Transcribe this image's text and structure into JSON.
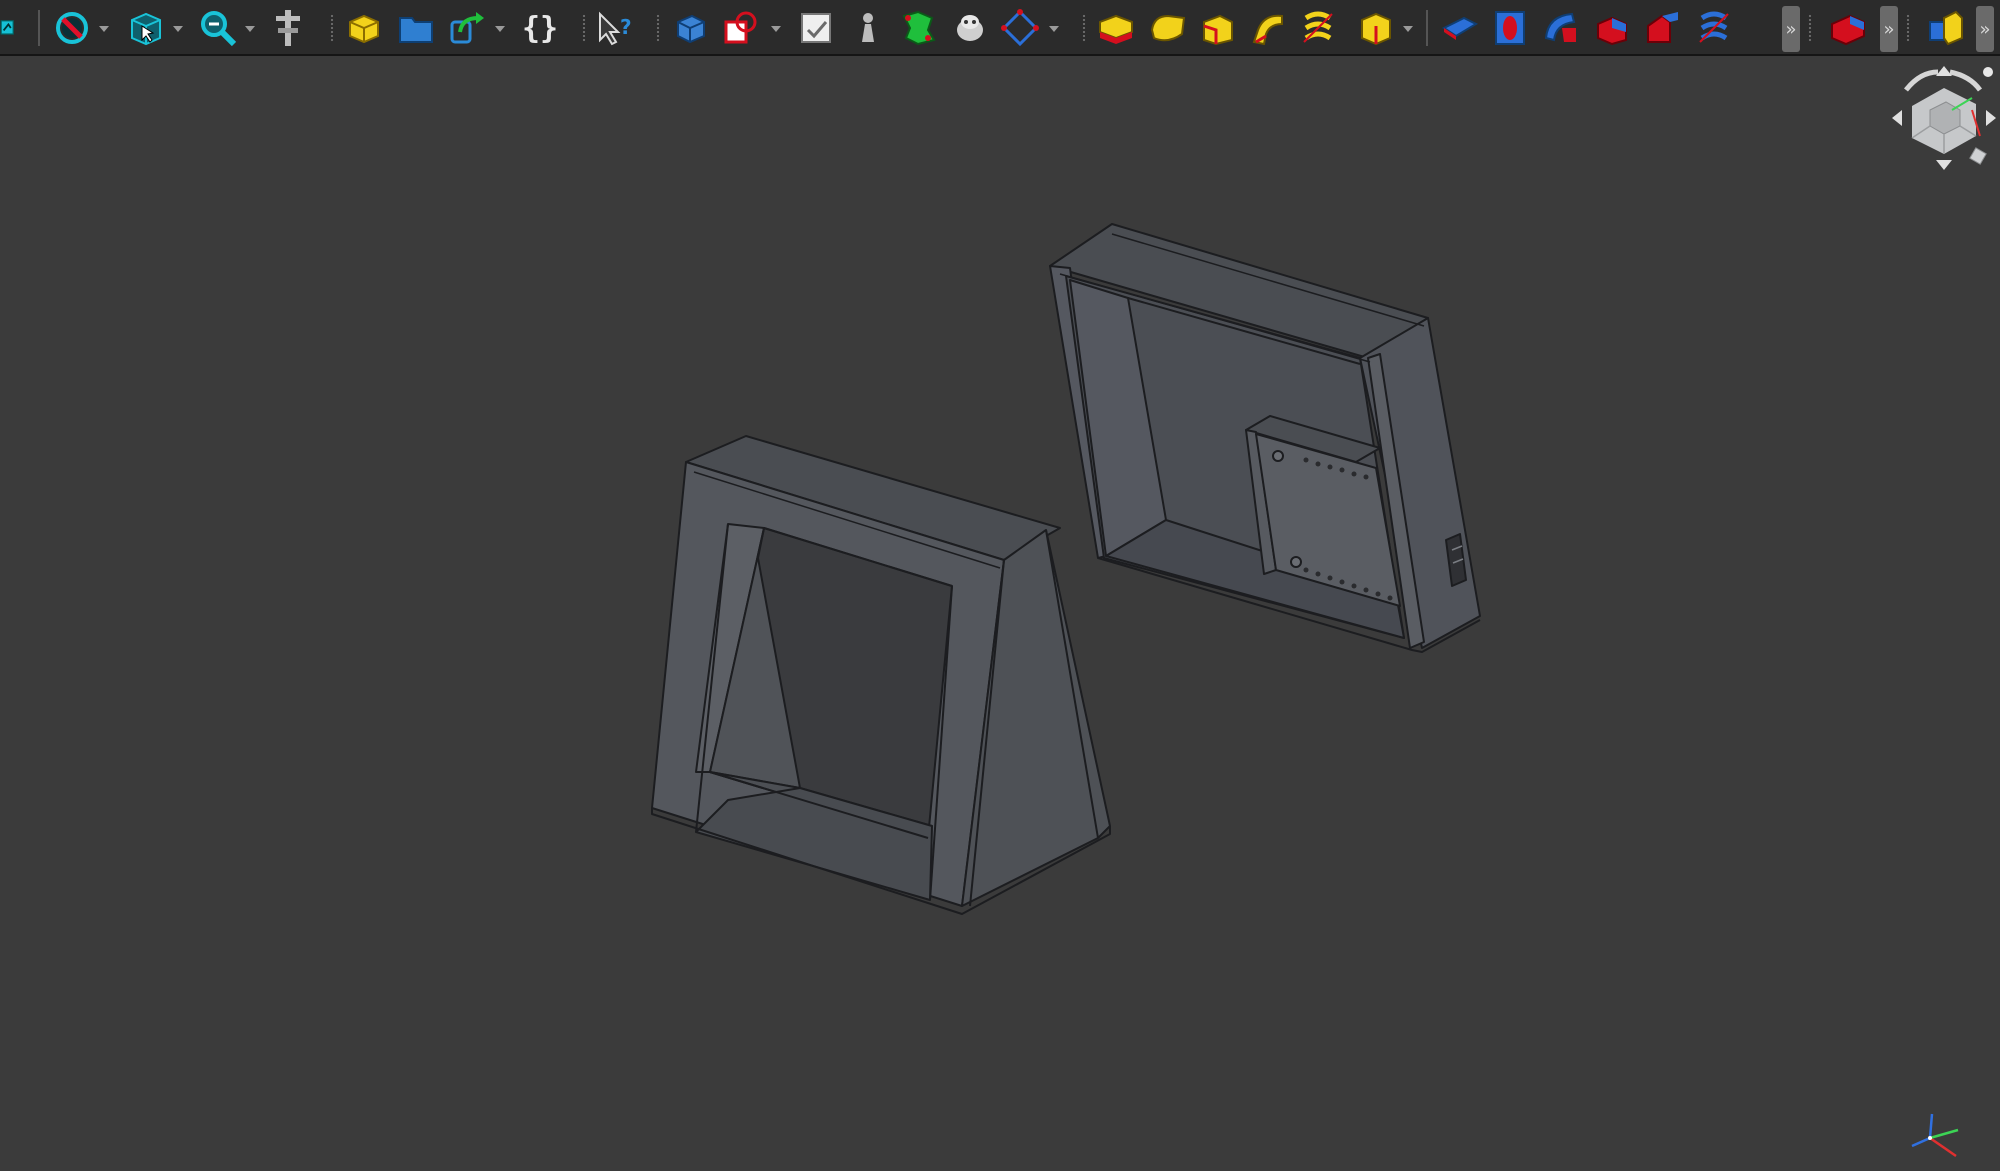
{
  "toolbar": {
    "braces_label": "{}",
    "overflow_label": "»",
    "icons": [
      "workbench-icon",
      "draw-style-icon",
      "std-view-box-icon",
      "zoom-fit-icon",
      "measure-icon",
      "new-document-icon",
      "open-document-icon",
      "redo-icon",
      "macro-icon",
      "whats-this-icon",
      "part-body-icon",
      "shape-binder-icon",
      "clone-icon",
      "sketch-icon",
      "attachment-icon",
      "draft-manager-icon",
      "pad-icon",
      "revolution-icon",
      "additive-loft-icon",
      "additive-pipe-icon",
      "additive-helix-icon",
      "additive-primitive-icon",
      "pocket-icon",
      "hole-icon",
      "groove-icon",
      "subtractive-loft-icon",
      "subtractive-pipe-icon",
      "subtractive-helix-icon",
      "fillet-icon",
      "assembly-icon"
    ]
  },
  "colors": {
    "background": "#3b3b3b",
    "model_face": "#4d5055",
    "model_edge": "#1e1f22",
    "toolbar": "#2b2b2b"
  },
  "viewport": {
    "objects": [
      "display-stand-frame",
      "display-enclosure-box"
    ],
    "navigation_cube": "nav-cube-icon",
    "axis_indicator": "axis-cross-icon"
  }
}
